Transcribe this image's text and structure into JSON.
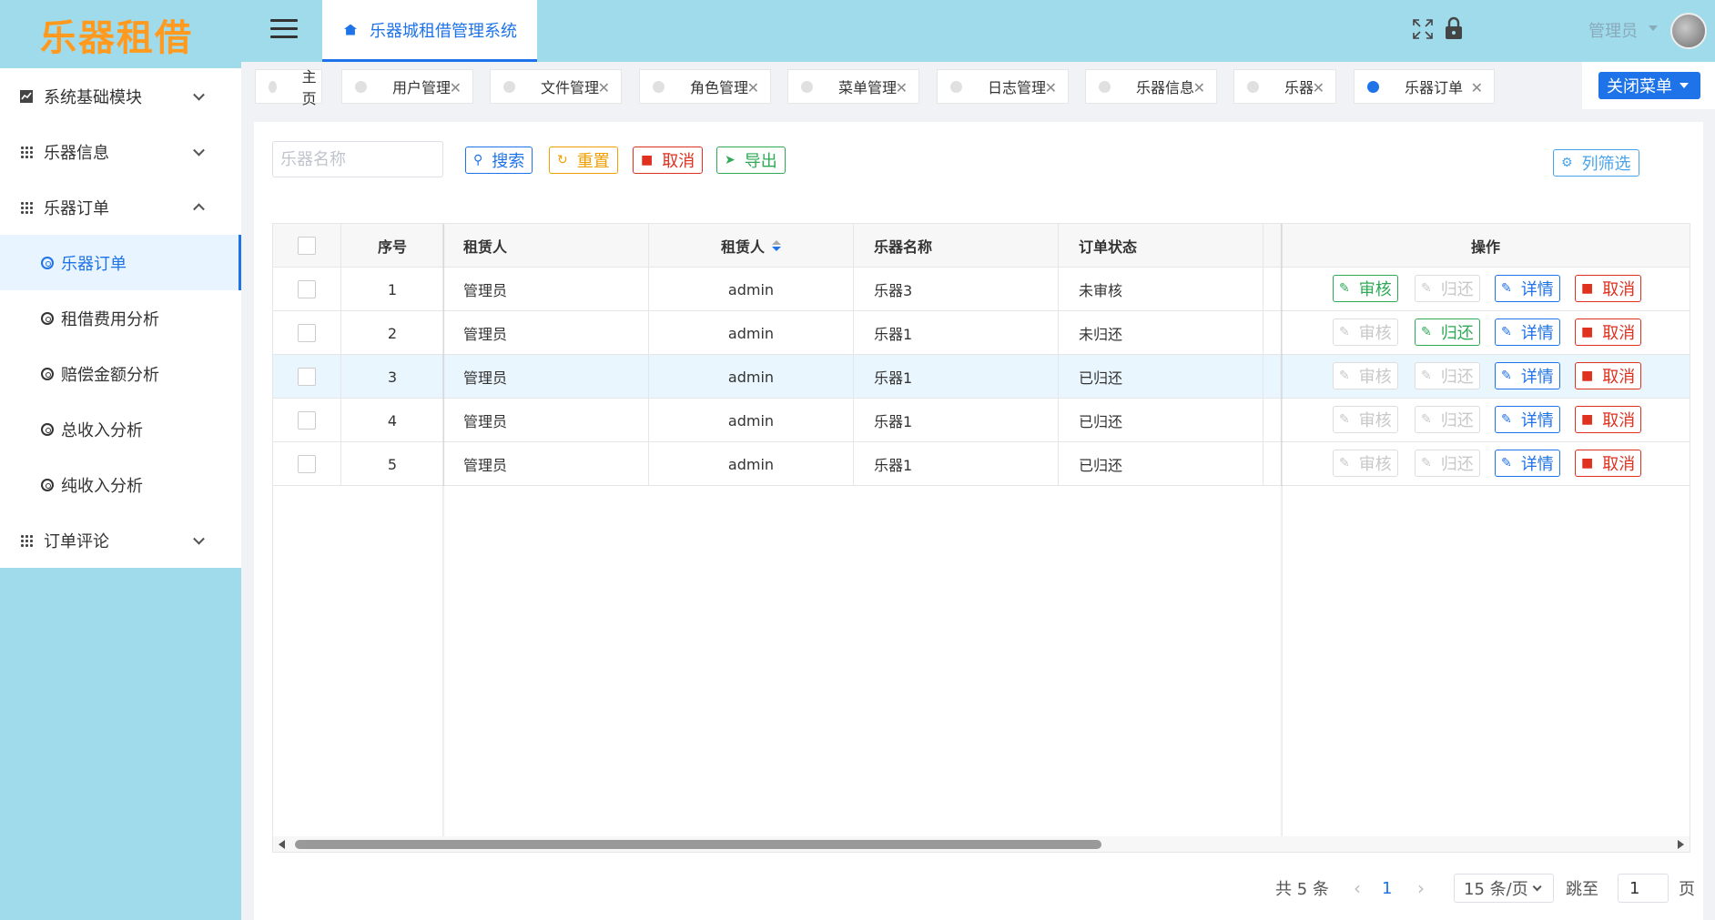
{
  "app": {
    "logo": "乐器租借",
    "system_title": "乐器城租借管理系统",
    "user_name": "管理员"
  },
  "sidebar": {
    "items": [
      {
        "label": "系统基础模块",
        "icon": "chart-icon",
        "expanded": false
      },
      {
        "label": "乐器信息",
        "icon": "grid-icon",
        "expanded": false
      },
      {
        "label": "乐器订单",
        "icon": "grid-icon",
        "expanded": true
      },
      {
        "label": "订单评论",
        "icon": "grid-icon",
        "expanded": false
      }
    ],
    "sub_items": [
      {
        "label": "乐器订单",
        "active": true
      },
      {
        "label": "租借费用分析",
        "active": false
      },
      {
        "label": "赔偿金额分析",
        "active": false
      },
      {
        "label": "总收入分析",
        "active": false
      },
      {
        "label": "纯收入分析",
        "active": false
      }
    ]
  },
  "tabs": [
    {
      "label": "主页",
      "closable": false,
      "active": false
    },
    {
      "label": "用户管理",
      "closable": true,
      "active": false
    },
    {
      "label": "文件管理",
      "closable": true,
      "active": false
    },
    {
      "label": "角色管理",
      "closable": true,
      "active": false
    },
    {
      "label": "菜单管理",
      "closable": true,
      "active": false
    },
    {
      "label": "日志管理",
      "closable": true,
      "active": false
    },
    {
      "label": "乐器信息",
      "closable": true,
      "active": false
    },
    {
      "label": "乐器",
      "closable": true,
      "active": false
    },
    {
      "label": "乐器订单",
      "closable": true,
      "active": true
    }
  ],
  "close_menu_label": "关闭菜单",
  "toolbar": {
    "search_placeholder": "乐器名称",
    "search_label": "搜索",
    "reset_label": "重置",
    "cancel_label": "取消",
    "export_label": "导出",
    "column_filter_label": "列筛选"
  },
  "table": {
    "headers": {
      "index": "序号",
      "renter": "租赁人",
      "renter_sort": "租赁人",
      "instrument": "乐器名称",
      "status": "订单状态",
      "actions": "操作"
    },
    "rows": [
      {
        "index": "1",
        "renter": "管理员",
        "account": "admin",
        "instrument": "乐器3",
        "status": "未审核",
        "audit_enabled": true,
        "return_enabled": false,
        "highlight": false
      },
      {
        "index": "2",
        "renter": "管理员",
        "account": "admin",
        "instrument": "乐器1",
        "status": "未归还",
        "audit_enabled": false,
        "return_enabled": true,
        "highlight": false
      },
      {
        "index": "3",
        "renter": "管理员",
        "account": "admin",
        "instrument": "乐器1",
        "status": "已归还",
        "audit_enabled": false,
        "return_enabled": false,
        "highlight": true
      },
      {
        "index": "4",
        "renter": "管理员",
        "account": "admin",
        "instrument": "乐器1",
        "status": "已归还",
        "audit_enabled": false,
        "return_enabled": false,
        "highlight": false
      },
      {
        "index": "5",
        "renter": "管理员",
        "account": "admin",
        "instrument": "乐器1",
        "status": "已归还",
        "audit_enabled": false,
        "return_enabled": false,
        "highlight": false
      }
    ],
    "action_labels": {
      "audit": "审核",
      "return": "归还",
      "detail": "详情",
      "cancel": "取消"
    }
  },
  "pagination": {
    "total_text": "共 5 条",
    "current_page": "1",
    "page_size": "15 条/页",
    "jump_label": "跳至",
    "jump_value": "1",
    "page_suffix": "页"
  },
  "colors": {
    "primary": "#1e73e8",
    "sidebar_bg": "#a0dbeb",
    "logo": "#ff9a1f",
    "success": "#2eaa55",
    "danger": "#e0301e",
    "warning": "#f0a000"
  }
}
